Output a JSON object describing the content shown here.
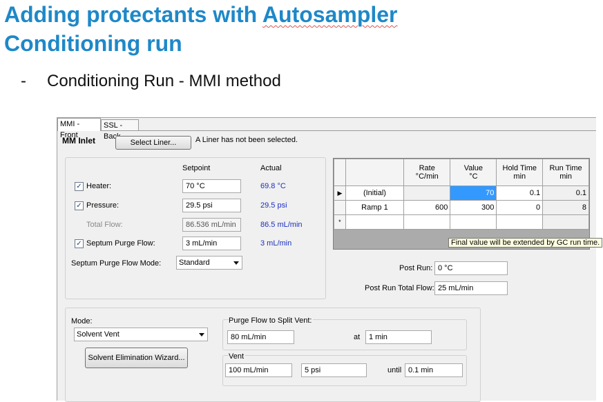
{
  "slide": {
    "title_line1_prefix": "Adding protectants with ",
    "title_line1_underlined": "Autosampler",
    "title_line2": "Conditioning run",
    "bullet_dash": "-",
    "bullet_text": "Conditioning Run -  MMI method"
  },
  "tabs": [
    {
      "label": "MMI - Front",
      "active": true
    },
    {
      "label": "SSL - Back",
      "active": false
    }
  ],
  "inlet": {
    "heading": "MM Inlet",
    "select_liner_button": "Select Liner...",
    "liner_status": "A Liner has not been selected."
  },
  "params": {
    "col_setpoint": "Setpoint",
    "col_actual": "Actual",
    "heater": {
      "label": "Heater:",
      "checked": true,
      "setpoint": "70 °C",
      "actual": "69.8 °C"
    },
    "pressure": {
      "label": "Pressure:",
      "checked": true,
      "setpoint": "29.5 psi",
      "actual": "29.5 psi"
    },
    "total_flow": {
      "label": "Total Flow:",
      "setpoint": "86.536 mL/min",
      "actual": "86.5 mL/min"
    },
    "septum_purge": {
      "label": "Septum Purge Flow:",
      "checked": true,
      "setpoint": "3 mL/min",
      "actual": "3 mL/min"
    },
    "septum_mode": {
      "label": "Septum Purge Flow Mode:",
      "value": "Standard"
    }
  },
  "ramp_table": {
    "headers": [
      {
        "line1": "Rate",
        "line2": "°C/min"
      },
      {
        "line1": "Value",
        "line2": "°C"
      },
      {
        "line1": "Hold Time",
        "line2": "min"
      },
      {
        "line1": "Run Time",
        "line2": "min"
      }
    ],
    "rows": [
      {
        "marker": "▶",
        "name": "(Initial)",
        "rate": "",
        "value": "70",
        "hold": "0.1",
        "run": "0.1"
      },
      {
        "marker": "",
        "name": "Ramp 1",
        "rate": "600",
        "value": "300",
        "hold": "0",
        "run": "8"
      },
      {
        "marker": "*",
        "name": "",
        "rate": "",
        "value": "",
        "hold": "",
        "run": ""
      }
    ],
    "tooltip": "Final value will be extended by GC run time."
  },
  "post_run": {
    "label": "Post Run:",
    "value": "0 °C",
    "total_flow_label": "Post Run Total Flow:",
    "total_flow_value": "25 mL/min"
  },
  "mode": {
    "label": "Mode:",
    "value": "Solvent Vent",
    "wizard_button": "Solvent Elimination Wizard..."
  },
  "purge_flow": {
    "group_label": "Purge Flow to Split Vent:",
    "flow": "80 mL/min",
    "at_label": "at",
    "time": "1 min"
  },
  "vent": {
    "group_label": "Vent",
    "flow": "100 mL/min",
    "pressure": "5 psi",
    "until_label": "until",
    "until_value": "0.1 min"
  },
  "colors": {
    "title": "#1e88c8",
    "actual_value": "#1b2fbf",
    "selected_cell": "#3399ff",
    "tooltip_bg": "#ffffe1"
  }
}
